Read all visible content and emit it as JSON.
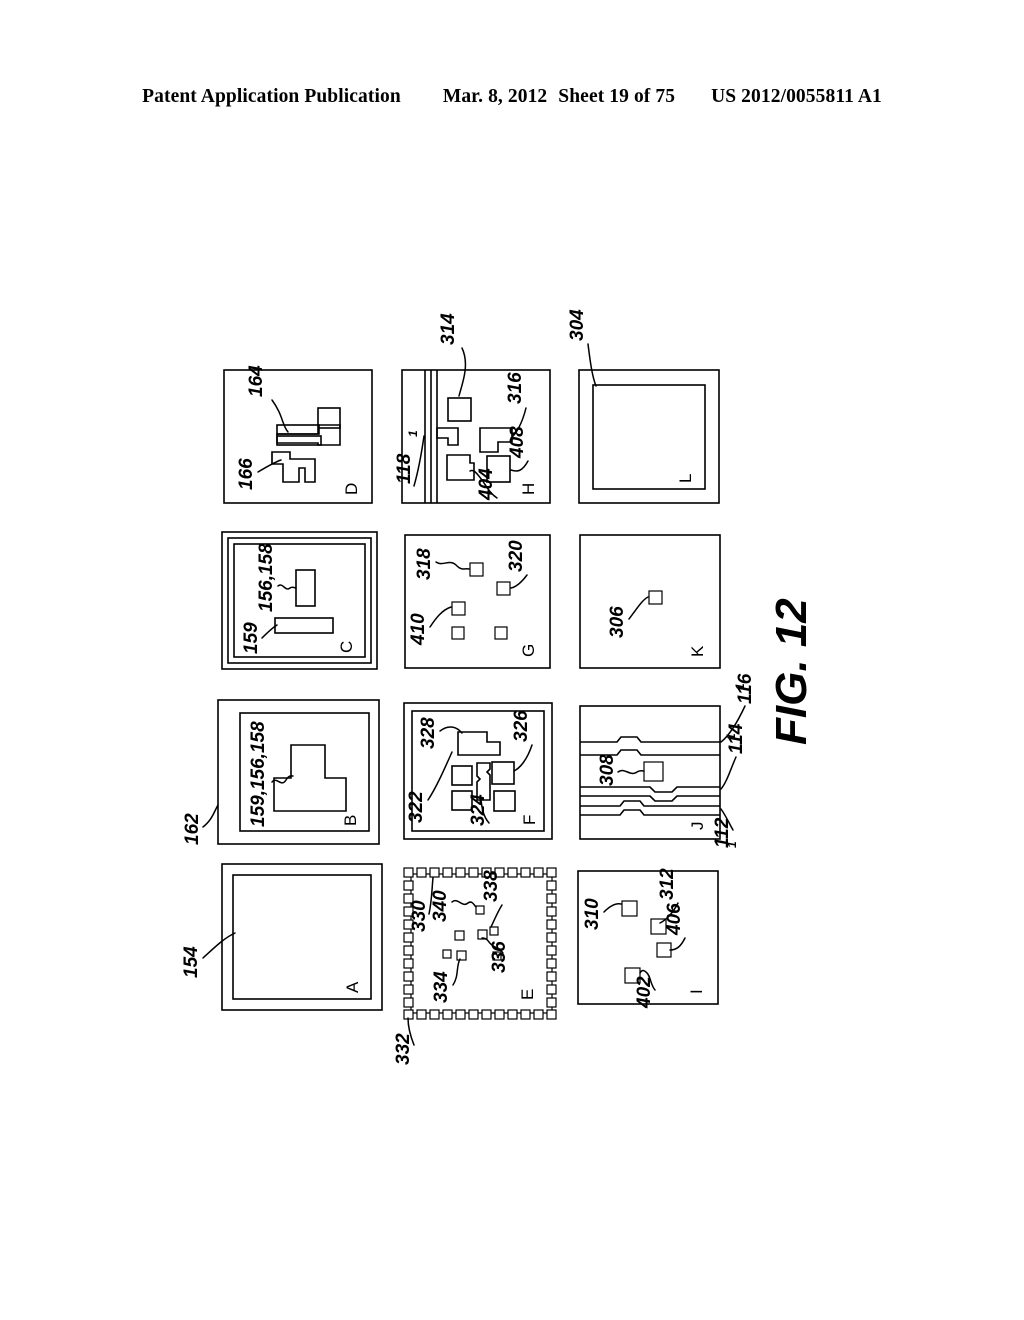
{
  "header": {
    "publication": "Patent Application Publication",
    "date": "Mar. 8, 2012",
    "sheet": "Sheet 19 of 75",
    "number": "US 2012/0055811 A1"
  },
  "figure": {
    "title": "FIG. 12",
    "outer_refs": [
      {
        "id": "154",
        "text": "154"
      },
      {
        "id": "162",
        "text": "162"
      },
      {
        "id": "332",
        "text": "332"
      },
      {
        "id": "112",
        "text": "112",
        "sub": "1"
      },
      {
        "id": "114",
        "text": "114",
        "sub": "1"
      },
      {
        "id": "116",
        "text": "116",
        "sub": "1"
      },
      {
        "id": "304",
        "text": "304"
      },
      {
        "id": "314",
        "text": "314"
      }
    ],
    "panels": [
      {
        "letter": "A",
        "name": "panel-a",
        "refs": [
          "154"
        ],
        "description": "plain substrate outline"
      },
      {
        "letter": "B",
        "name": "panel-b",
        "refs": [
          "159,156,158"
        ],
        "description": "T-shaped feature"
      },
      {
        "letter": "C",
        "name": "panel-c",
        "refs": [
          "156,158",
          "159"
        ],
        "description": "two rectangular features"
      },
      {
        "letter": "D",
        "name": "panel-d",
        "refs": [
          "164",
          "166"
        ],
        "description": "stepped conductor traces"
      },
      {
        "letter": "E",
        "name": "panel-e",
        "refs": [
          "330",
          "340",
          "338",
          "334",
          "336",
          "332"
        ],
        "description": "perimeter pad ring with interior pads"
      },
      {
        "letter": "F",
        "name": "panel-f",
        "refs": [
          "328",
          "326",
          "322",
          "324"
        ],
        "description": "cluster of component pads"
      },
      {
        "letter": "G",
        "name": "panel-g",
        "refs": [
          "318",
          "320",
          "410"
        ],
        "description": "five small square pads"
      },
      {
        "letter": "H",
        "name": "panel-h",
        "refs": [
          "314",
          "316",
          "408",
          "404",
          "118"
        ],
        "sub_ref": "118",
        "sub_index": "1",
        "description": "vertical rails with pads"
      },
      {
        "letter": "I",
        "name": "panel-i",
        "refs": [
          "310",
          "312",
          "406",
          "402"
        ],
        "description": "four diagonal pads"
      },
      {
        "letter": "J",
        "name": "panel-j",
        "refs": [
          "308",
          "114",
          "116",
          "112"
        ],
        "description": "stacked layer cross-section"
      },
      {
        "letter": "K",
        "name": "panel-k",
        "refs": [
          "306"
        ],
        "description": "single small pad"
      },
      {
        "letter": "L",
        "name": "panel-l",
        "refs": [
          "304"
        ],
        "description": "nested frame outline"
      }
    ]
  }
}
